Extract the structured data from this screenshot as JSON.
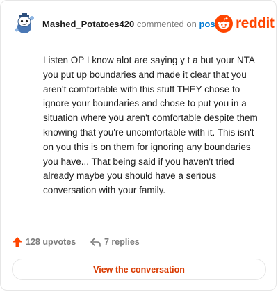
{
  "comment": {
    "username": "Mashed_Potatoes420",
    "action_text": "commented on",
    "post_link_text": "post",
    "body": "Listen OP I know alot are saying y t a but your NTA you put up boundaries and made it clear that you aren't comfortable with this stuff THEY chose to ignore your boundaries and chose to put you in a situation where you aren't comfortable despite them knowing that you're uncomfortable with it. This isn't on you this is on them for ignoring any boundaries you have... That being said if you haven't tried already maybe you should have a serious conversation with your family."
  },
  "brand": {
    "name": "reddit",
    "icon": "reddit-snoo-icon",
    "color": "#ff4500"
  },
  "footer": {
    "upvotes_label": "128 upvotes",
    "upvote_icon": "upvote-arrow-icon",
    "upvote_color": "#ff4500",
    "replies_label": "7 replies",
    "reply_icon": "reply-arrow-icon"
  },
  "cta": {
    "label": "View the conversation",
    "color": "#d93a00"
  },
  "colors": {
    "link": "#0079d3",
    "muted": "#7c7c7c",
    "text": "#1c1c1c"
  }
}
